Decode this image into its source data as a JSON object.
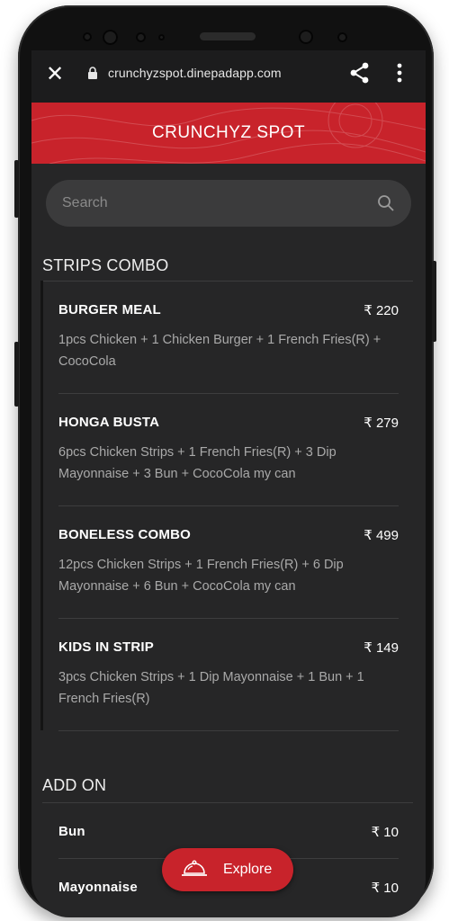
{
  "browser": {
    "url": "crunchyzspot.dinepadapp.com"
  },
  "header": {
    "title": "CRUNCHYZ SPOT"
  },
  "search": {
    "placeholder": "Search"
  },
  "sections": [
    {
      "title": "STRIPS COMBO",
      "items": [
        {
          "name": "BURGER MEAL",
          "price": "₹ 220",
          "desc": "1pcs Chicken + 1 Chicken Burger + 1 French Fries(R) + CocoCola"
        },
        {
          "name": "HONGA BUSTA",
          "price": "₹ 279",
          "desc": "6pcs Chicken Strips + 1 French Fries(R) + 3 Dip Mayonnaise + 3 Bun + CocoCola my can"
        },
        {
          "name": "BONELESS COMBO",
          "price": "₹ 499",
          "desc": "12pcs Chicken Strips + 1 French Fries(R) + 6 Dip Mayonnaise + 6 Bun + CocoCola my can"
        },
        {
          "name": "KIDS IN STRIP",
          "price": "₹ 149",
          "desc": "3pcs Chicken Strips + 1 Dip Mayonnaise + 1 Bun + 1 French Fries(R)"
        }
      ]
    },
    {
      "title": "ADD ON",
      "items": [
        {
          "name": "Bun",
          "price": "₹ 10"
        },
        {
          "name": "Mayonnaise",
          "price": "₹ 10"
        }
      ]
    }
  ],
  "explore": {
    "label": "Explore"
  },
  "colors": {
    "brand_red": "#c8232b",
    "background": "#262627"
  },
  "icons": [
    "close-icon",
    "lock-icon",
    "share-icon",
    "more-vertical-icon",
    "search-icon",
    "food-cloche-icon"
  ]
}
